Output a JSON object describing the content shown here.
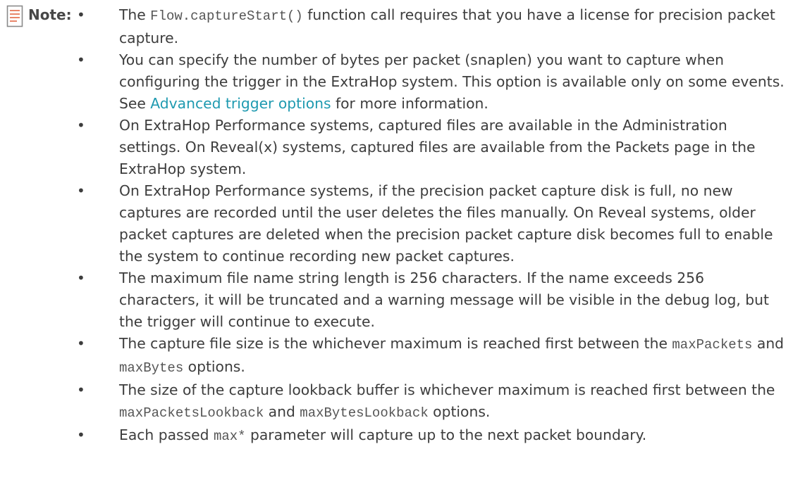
{
  "note": {
    "label": "Note:",
    "icon": "note-icon",
    "accent_color": "#e8866a",
    "link_color": "#1f9ab0",
    "items": [
      {
        "parts": [
          {
            "t": "The "
          },
          {
            "t": "Flow.captureStart()",
            "code": true
          },
          {
            "t": " function call requires that you have a license for precision packet capture."
          }
        ]
      },
      {
        "parts": [
          {
            "t": "You can specify the number of bytes per packet (snaplen) you want to capture when configuring the trigger in the ExtraHop system. This option is available only on some events. See "
          },
          {
            "t": "Advanced trigger options",
            "link": true
          },
          {
            "t": " for more information."
          }
        ]
      },
      {
        "parts": [
          {
            "t": "On ExtraHop Performance systems, captured files are available in the Administration settings. On Reveal(x) systems, captured files are available from the Packets page in the ExtraHop system."
          }
        ]
      },
      {
        "parts": [
          {
            "t": "On ExtraHop Performance systems, if the precision packet capture disk is full, no new captures are recorded until the user deletes the files manually. On Reveal systems, older packet captures are deleted when the precision packet capture disk becomes full to enable the system to continue recording new packet captures."
          }
        ]
      },
      {
        "parts": [
          {
            "t": "The maximum file name string length is 256 characters. If the name exceeds 256 characters, it will be truncated and a warning message will be visible in the debug log, but the trigger will continue to execute."
          }
        ]
      },
      {
        "parts": [
          {
            "t": "The capture file size is the whichever maximum is reached first between the "
          },
          {
            "t": "maxPackets",
            "code": true
          },
          {
            "t": " and "
          },
          {
            "t": "maxBytes",
            "code": true
          },
          {
            "t": " options."
          }
        ]
      },
      {
        "parts": [
          {
            "t": "The size of the capture lookback buffer is whichever maximum is reached first between the "
          },
          {
            "t": "maxPacketsLookback",
            "code": true
          },
          {
            "t": " and "
          },
          {
            "t": "maxBytesLookback",
            "code": true
          },
          {
            "t": " options."
          }
        ]
      },
      {
        "parts": [
          {
            "t": "Each passed "
          },
          {
            "t": "max*",
            "code": true
          },
          {
            "t": " parameter will capture up to the next packet boundary."
          }
        ]
      }
    ]
  }
}
